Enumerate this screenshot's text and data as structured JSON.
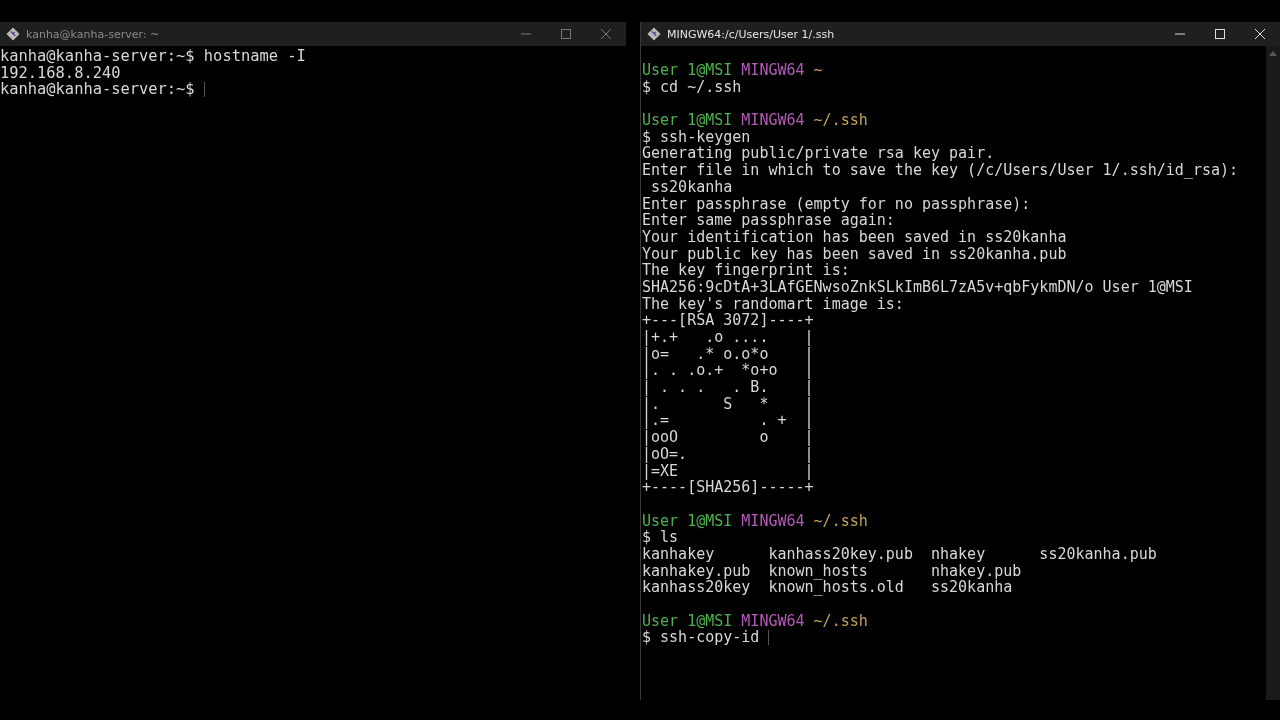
{
  "windows": [
    {
      "title": "kanha@kanha-server: ~",
      "active": false,
      "kind": "bash",
      "lines": [
        {
          "kind": "text",
          "text": "kanha@kanha-server:~$ hostname -I",
          "cursor": false
        },
        {
          "kind": "text",
          "text": "192.168.8.240",
          "cursor": false
        },
        {
          "kind": "text",
          "text": "kanha@kanha-server:~$",
          "cursor": true
        }
      ]
    },
    {
      "title": "MINGW64:/c/Users/User 1/.ssh",
      "active": true,
      "kind": "mintty",
      "lines": [
        {
          "kind": "prompt",
          "user": "User 1@MSI",
          "system": "MINGW64",
          "path": "~"
        },
        {
          "kind": "text",
          "text": "$ cd ~/.ssh",
          "cursor": false
        },
        {
          "kind": "blank"
        },
        {
          "kind": "prompt",
          "user": "User 1@MSI",
          "system": "MINGW64",
          "path": "~/.ssh"
        },
        {
          "kind": "text",
          "text": "$ ssh-keygen",
          "cursor": false
        },
        {
          "kind": "text",
          "text": "Generating public/private rsa key pair.",
          "cursor": false
        },
        {
          "kind": "text",
          "text": "Enter file in which to save the key (/c/Users/User 1/.ssh/id_rsa):",
          "cursor": false
        },
        {
          "kind": "text",
          "text": " ss20kanha",
          "cursor": false
        },
        {
          "kind": "text",
          "text": "Enter passphrase (empty for no passphrase):",
          "cursor": false
        },
        {
          "kind": "text",
          "text": "Enter same passphrase again:",
          "cursor": false
        },
        {
          "kind": "text",
          "text": "Your identification has been saved in ss20kanha",
          "cursor": false
        },
        {
          "kind": "text",
          "text": "Your public key has been saved in ss20kanha.pub",
          "cursor": false
        },
        {
          "kind": "text",
          "text": "The key fingerprint is:",
          "cursor": false
        },
        {
          "kind": "text",
          "text": "SHA256:9cDtA+3LAfGENwsoZnkSLkImB6L7zA5v+qbFykmDN/o User 1@MSI",
          "cursor": false
        },
        {
          "kind": "text",
          "text": "The key's randomart image is:",
          "cursor": false
        },
        {
          "kind": "text",
          "text": "+---[RSA 3072]----+",
          "cursor": false
        },
        {
          "kind": "text",
          "text": "|+.+   .o ....    |",
          "cursor": false
        },
        {
          "kind": "text",
          "text": "|o=   .* o.o*o    |",
          "cursor": false
        },
        {
          "kind": "text",
          "text": "|. . .o.+  *o+o   |",
          "cursor": false
        },
        {
          "kind": "text",
          "text": "| . . .   . B.    |",
          "cursor": false
        },
        {
          "kind": "text",
          "text": "|.       S   *    |",
          "cursor": false
        },
        {
          "kind": "text",
          "text": "|.=          . +  |",
          "cursor": false
        },
        {
          "kind": "text",
          "text": "|ooO         o    |",
          "cursor": false
        },
        {
          "kind": "text",
          "text": "|oO=.             |",
          "cursor": false
        },
        {
          "kind": "text",
          "text": "|=XE              |",
          "cursor": false
        },
        {
          "kind": "text",
          "text": "+----[SHA256]-----+",
          "cursor": false
        },
        {
          "kind": "blank"
        },
        {
          "kind": "prompt",
          "user": "User 1@MSI",
          "system": "MINGW64",
          "path": "~/.ssh"
        },
        {
          "kind": "text",
          "text": "$ ls",
          "cursor": false
        },
        {
          "kind": "text",
          "text": "kanhakey      kanhass20key.pub  nhakey      ss20kanha.pub",
          "cursor": false
        },
        {
          "kind": "text",
          "text": "kanhakey.pub  known_hosts       nhakey.pub",
          "cursor": false
        },
        {
          "kind": "text",
          "text": "kanhass20key  known_hosts.old   ss20kanha",
          "cursor": false
        },
        {
          "kind": "blank"
        },
        {
          "kind": "prompt",
          "user": "User 1@MSI",
          "system": "MINGW64",
          "path": "~/.ssh"
        },
        {
          "kind": "text",
          "text": "$ ssh-copy-id",
          "cursor": true
        }
      ]
    }
  ]
}
